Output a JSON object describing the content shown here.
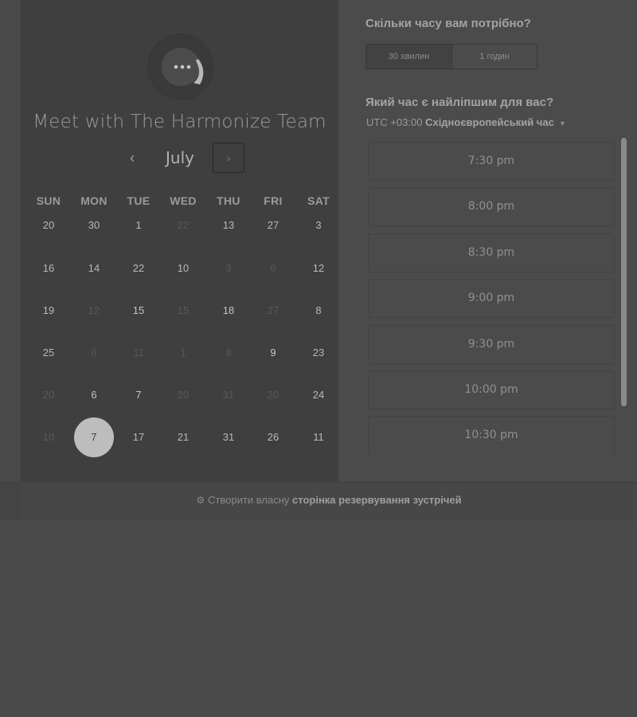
{
  "title": "Meet with The Harmonize Team",
  "calendar": {
    "month": "July",
    "prev_icon": "‹",
    "next_icon": "›",
    "weekdays": [
      "SUN",
      "MON",
      "TUE",
      "WED",
      "THU",
      "FRI",
      "SAT"
    ],
    "weeks": [
      [
        {
          "d": "20",
          "s": "n"
        },
        {
          "d": "30",
          "s": "n"
        },
        {
          "d": "1",
          "s": "n"
        },
        {
          "d": "22",
          "s": "dim"
        },
        {
          "d": "13",
          "s": "n"
        },
        {
          "d": "27",
          "s": "n"
        },
        {
          "d": "3",
          "s": "n"
        }
      ],
      [
        {
          "d": "16",
          "s": "n"
        },
        {
          "d": "14",
          "s": "n"
        },
        {
          "d": "22",
          "s": "n"
        },
        {
          "d": "10",
          "s": "n"
        },
        {
          "d": "3",
          "s": "dim"
        },
        {
          "d": "6",
          "s": "dim"
        },
        {
          "d": "12",
          "s": "n"
        }
      ],
      [
        {
          "d": "19",
          "s": "n"
        },
        {
          "d": "12",
          "s": "dim"
        },
        {
          "d": "15",
          "s": "avail"
        },
        {
          "d": "15",
          "s": "dim"
        },
        {
          "d": "18",
          "s": "avail"
        },
        {
          "d": "27",
          "s": "dim"
        },
        {
          "d": "8",
          "s": "n"
        }
      ],
      [
        {
          "d": "25",
          "s": "n"
        },
        {
          "d": "6",
          "s": "dim"
        },
        {
          "d": "11",
          "s": "dim"
        },
        {
          "d": "1",
          "s": "dim"
        },
        {
          "d": "8",
          "s": "dim"
        },
        {
          "d": "9",
          "s": "avail"
        },
        {
          "d": "23",
          "s": "n"
        }
      ],
      [
        {
          "d": "20",
          "s": "dim"
        },
        {
          "d": "6",
          "s": "avail"
        },
        {
          "d": "7",
          "s": "avail"
        },
        {
          "d": "20",
          "s": "dim"
        },
        {
          "d": "31",
          "s": "dim"
        },
        {
          "d": "20",
          "s": "dim"
        },
        {
          "d": "24",
          "s": "n"
        }
      ],
      [
        {
          "d": "10",
          "s": "dim"
        },
        {
          "d": "7",
          "s": "selected"
        },
        {
          "d": "17",
          "s": "n"
        },
        {
          "d": "21",
          "s": "n"
        },
        {
          "d": "31",
          "s": "n"
        },
        {
          "d": "26",
          "s": "n"
        },
        {
          "d": "11",
          "s": "n"
        }
      ]
    ]
  },
  "duration": {
    "question": "Скільки часу вам потрібно?",
    "options": [
      "30 хвилин",
      "1 годин"
    ]
  },
  "time": {
    "question": "Який час є найліпшим для вас?",
    "tz_prefix": "UTC +03:00 ",
    "tz_name": "Східноєвропейський час",
    "slots": [
      "7:30 pm",
      "8:00 pm",
      "8:30 pm",
      "9:00 pm",
      "9:30 pm",
      "10:00 pm",
      "10:30 pm"
    ]
  },
  "footer": {
    "prefix": "Створити власну ",
    "link": "сторінка резервування зустрічей"
  }
}
